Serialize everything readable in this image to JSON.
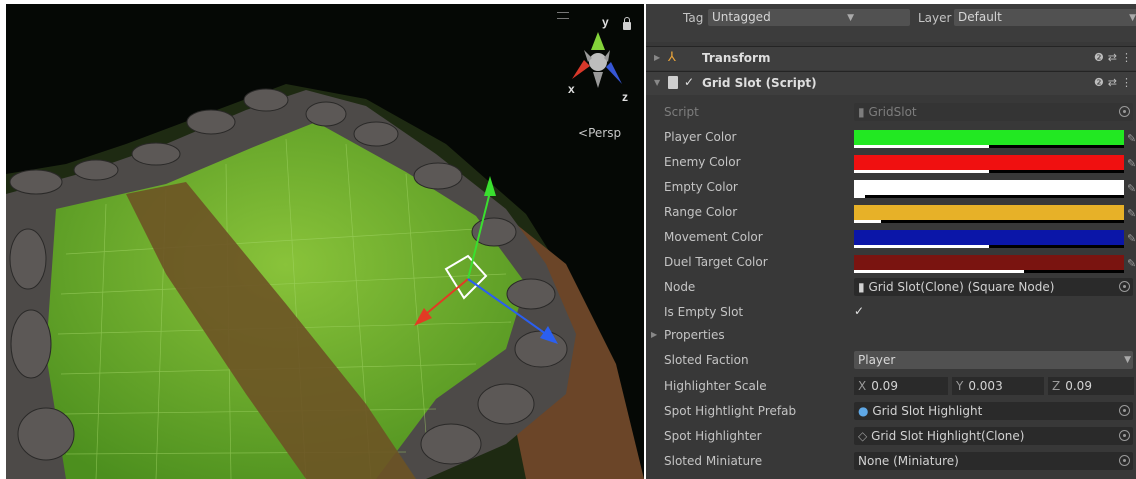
{
  "scene": {
    "persp_label": "Persp",
    "gizmo_axes": {
      "y": "y",
      "x": "x",
      "z": "z"
    }
  },
  "inspector": {
    "tag_label": "Tag",
    "tag_value": "Untagged",
    "layer_label": "Layer",
    "layer_value": "Default",
    "transform_title": "Transform",
    "component_title": "Grid Slot (Script)",
    "fields": {
      "script_label": "Script",
      "script_value": "GridSlot",
      "player_color_label": "Player Color",
      "enemy_color_label": "Enemy Color",
      "empty_color_label": "Empty Color",
      "range_color_label": "Range Color",
      "movement_color_label": "Movement Color",
      "duel_target_color_label": "Duel Target Color",
      "node_label": "Node",
      "node_value": "Grid Slot(Clone) (Square Node)",
      "is_empty_slot_label": "Is Empty Slot",
      "properties_label": "Properties",
      "sloted_faction_label": "Sloted Faction",
      "sloted_faction_value": "Player",
      "highlighter_scale_label": "Highlighter Scale",
      "scale_x": "0.09",
      "scale_y": "0.003",
      "scale_z": "0.09",
      "spot_prefab_label": "Spot Hightlight Prefab",
      "spot_prefab_value": "Grid Slot Highlight",
      "spot_highlighter_label": "Spot Highlighter",
      "spot_highlighter_value": "Grid Slot Highlight(Clone)",
      "sloted_miniature_label": "Sloted Miniature",
      "sloted_miniature_value": "None (Miniature)"
    },
    "colors": {
      "player": "#22e822",
      "enemy": "#f01010",
      "empty": "#ffffff",
      "range": "#e7b128",
      "movement": "#0b16a8",
      "duel_target": "#7a1410"
    },
    "alpha_fractions": {
      "player": 0.5,
      "enemy": 0.5,
      "empty": 0.04,
      "range": 0.1,
      "movement": 0.5,
      "duel_target": 0.63
    }
  }
}
